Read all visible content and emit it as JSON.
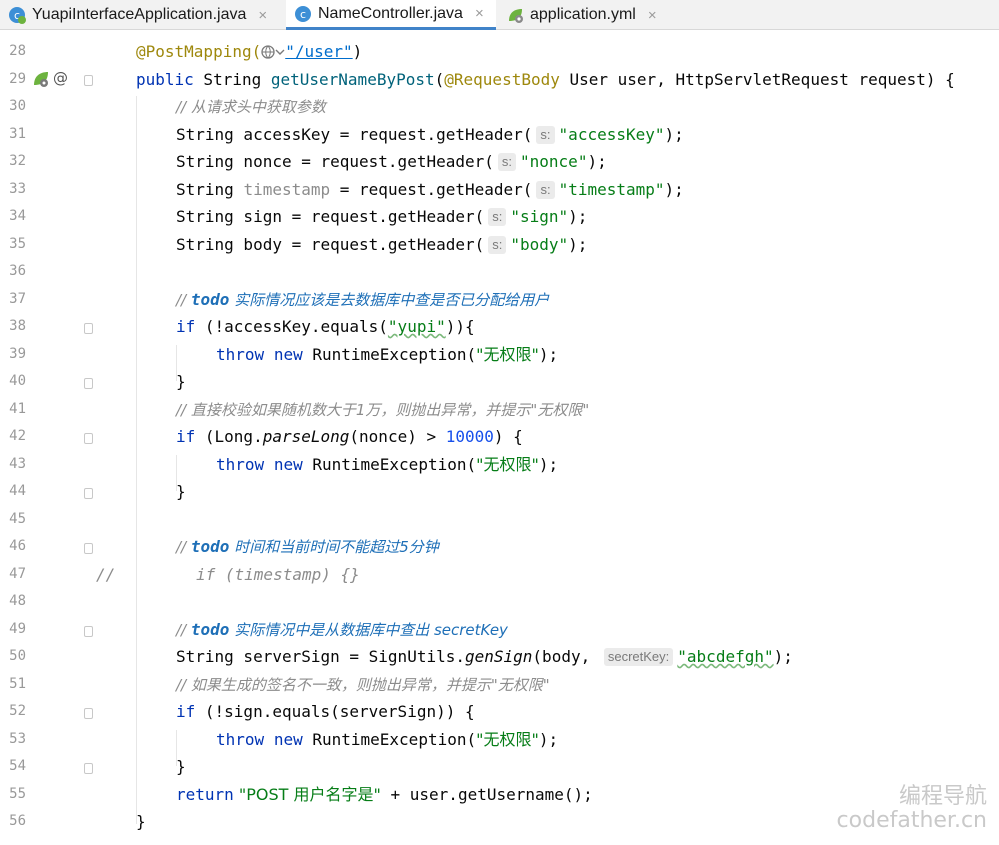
{
  "tabs": [
    {
      "label": "YuapiInterfaceApplication.java",
      "icon": "spring-class-icon",
      "active": false
    },
    {
      "label": "NameController.java",
      "icon": "class-icon",
      "active": true
    },
    {
      "label": "application.yml",
      "icon": "yaml-icon",
      "active": false
    }
  ],
  "close_glyph": "×",
  "gutter": {
    "line_numbers": [
      "28",
      "29",
      "30",
      "31",
      "32",
      "33",
      "34",
      "35",
      "36",
      "37",
      "38",
      "39",
      "40",
      "41",
      "42",
      "43",
      "44",
      "45",
      "46",
      "47",
      "48",
      "49",
      "50",
      "51",
      "52",
      "53",
      "54",
      "55",
      "56"
    ],
    "gutter_marker_29": "@"
  },
  "code": {
    "l28": {
      "ann": "@PostMapping(",
      "url": "\"/user\"",
      "close": ")"
    },
    "l29": {
      "kw": "public",
      "t1": " String ",
      "method": "getUserNameByPost",
      "t2": "(",
      "ann": "@RequestBody",
      "t3": " User user, HttpServletRequest request) {"
    },
    "l30": {
      "comment": "// 从请求头中获取参数"
    },
    "l31": {
      "t1": "String accessKey = request.getHeader(",
      "hint": "s:",
      "str": "\"accessKey\"",
      "t2": ");"
    },
    "l32": {
      "t1": "String nonce = request.getHeader(",
      "hint": "s:",
      "str": "\"nonce\"",
      "t2": ");"
    },
    "l33": {
      "t1": "String ",
      "grey": "timestamp",
      "t2": " = request.getHeader(",
      "hint": "s:",
      "str": "\"timestamp\"",
      "t3": ");"
    },
    "l34": {
      "t1": "String sign = request.getHeader(",
      "hint": "s:",
      "str": "\"sign\"",
      "t2": ");"
    },
    "l35": {
      "t1": "String body = request.getHeader(",
      "hint": "s:",
      "str": "\"body\"",
      "t2": ");"
    },
    "l37": {
      "slashes": "// ",
      "todo": "todo",
      "text": " 实际情况应该是去数据库中查是否已分配给用户"
    },
    "l38": {
      "kw": "if",
      "t1": " (!accessKey.equals(",
      "str": "\"yupi\"",
      "t2": ")){"
    },
    "l39": {
      "kw1": "throw",
      "kw2": "new",
      "t1": " RuntimeException(",
      "str": "\"无权限\"",
      "t2": ");"
    },
    "l40": {
      "t1": "}"
    },
    "l41": {
      "comment": "// 直接校验如果随机数大于1万，则抛出异常，并提示\"无权限\""
    },
    "l42": {
      "kw": "if",
      "t1": " (Long.",
      "method": "parseLong",
      "t2": "(nonce) > ",
      "num": "10000",
      "t3": ") {"
    },
    "l43": {
      "kw1": "throw",
      "kw2": "new",
      "t1": " RuntimeException(",
      "str": "\"无权限\"",
      "t2": ");"
    },
    "l44": {
      "t1": "}"
    },
    "l46": {
      "slashes": "// ",
      "todo": "todo",
      "text": " 时间和当前时间不能超过5分钟"
    },
    "l47": {
      "slashes": "//",
      "text": "if (timestamp) {}"
    },
    "l49": {
      "slashes": "// ",
      "todo": "todo",
      "text": " 实际情况中是从数据库中查出 secretKey"
    },
    "l50": {
      "t1": "String serverSign = SignUtils.",
      "method": "genSign",
      "t2": "(body, ",
      "hint": "secretKey:",
      "str": "\"abcdefgh\"",
      "t3": ");"
    },
    "l51": {
      "comment": "// 如果生成的签名不一致，则抛出异常，并提示\"无权限\""
    },
    "l52": {
      "kw": "if",
      "t1": " (!sign.equals(serverSign)) {"
    },
    "l53": {
      "kw1": "throw",
      "kw2": "new",
      "t1": " RuntimeException(",
      "str": "\"无权限\"",
      "t2": ");"
    },
    "l54": {
      "t1": "}"
    },
    "l55": {
      "kw": "return",
      "str": " \"POST 用户名字是\"",
      "t1": " + user.getUsername();"
    },
    "l56": {
      "t1": "}"
    }
  },
  "watermark": {
    "line1": "编程导航",
    "line2": "codefather.cn"
  },
  "colors": {
    "keyword": "#0033b3",
    "annotation": "#9e880d",
    "string": "#067d17",
    "number": "#1750eb",
    "comment": "#8c8c8c",
    "todo": "#1e6fb7",
    "tab_active_underline": "#4083c9"
  }
}
